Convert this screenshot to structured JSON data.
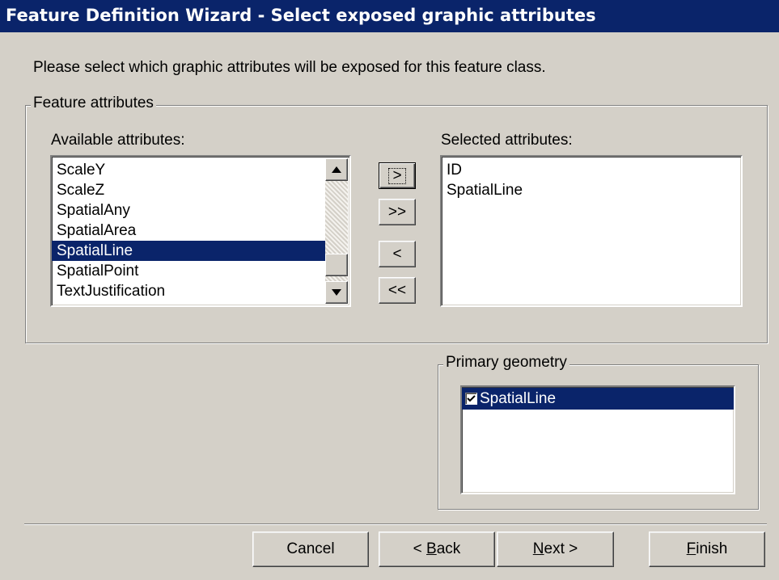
{
  "window": {
    "title": "Feature Definition Wizard - Select exposed graphic attributes"
  },
  "instruction": "Please select which graphic attributes will be exposed for this feature class.",
  "feature_attributes": {
    "group_label": "Feature attributes",
    "available": {
      "label": "Available attributes:",
      "items": [
        "ScaleY",
        "ScaleZ",
        "SpatialAny",
        "SpatialArea",
        "SpatialLine",
        "SpatialPoint",
        "TextJustification"
      ],
      "selected_item": "SpatialLine"
    },
    "selected": {
      "label": "Selected attributes:",
      "items": [
        "ID",
        "SpatialLine"
      ]
    },
    "move_buttons": {
      "add": ">",
      "add_all": ">>",
      "remove": "<",
      "remove_all": "<<"
    }
  },
  "primary_geometry": {
    "group_label": "Primary geometry",
    "items": [
      {
        "label": "SpatialLine",
        "checked": true
      }
    ]
  },
  "footer": {
    "cancel": "Cancel",
    "back_prefix": "< ",
    "back_key": "B",
    "back_rest": "ack",
    "next_key": "N",
    "next_rest": "ext >",
    "finish_key": "F",
    "finish_rest": "inish"
  },
  "colors": {
    "face": "#d4d0c8",
    "title_bar": "#0a246a",
    "selection": "#0a246a"
  },
  "icons": {
    "scroll_up": "triangle-up-icon",
    "scroll_down": "triangle-down-icon",
    "check": "checkmark-icon"
  }
}
